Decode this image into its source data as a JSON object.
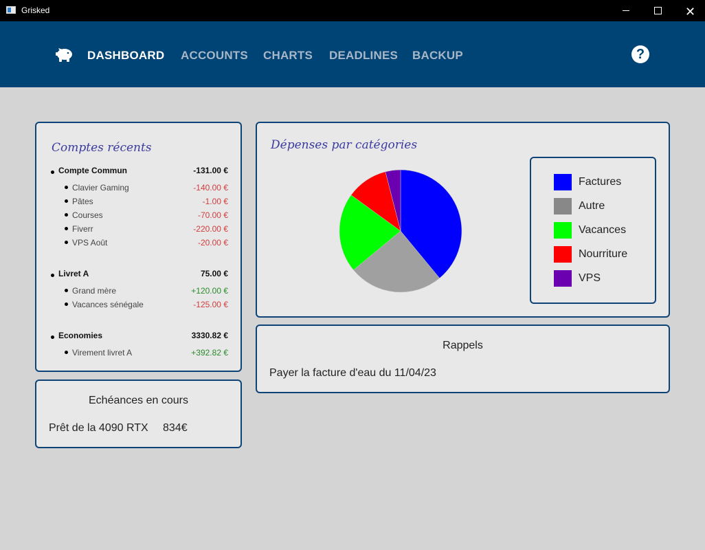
{
  "window": {
    "title": "Grisked"
  },
  "nav": {
    "items": [
      "DASHBOARD",
      "ACCOUNTS",
      "CHARTS",
      "DEADLINES",
      "BACKUP"
    ],
    "active": "DASHBOARD",
    "help": "?"
  },
  "comptes": {
    "title": "Comptes récents",
    "accounts": [
      {
        "name": "Compte Commun",
        "amount": "-131.00 €",
        "items": [
          {
            "label": "Clavier Gaming",
            "amount": "-140.00 €"
          },
          {
            "label": "Pâtes",
            "amount": "-1.00 €"
          },
          {
            "label": "Courses",
            "amount": "-70.00 €"
          },
          {
            "label": "Fiverr",
            "amount": "-220.00 €"
          },
          {
            "label": "VPS Août",
            "amount": "-20.00 €"
          }
        ]
      },
      {
        "name": "Livret A",
        "amount": "75.00 €",
        "items": [
          {
            "label": "Grand mère",
            "amount": "+120.00 €"
          },
          {
            "label": "Vacances sénégale",
            "amount": "-125.00 €"
          }
        ]
      },
      {
        "name": "Economies",
        "amount": "3330.82 €",
        "items": [
          {
            "label": "Virement livret A",
            "amount": "+392.82 €"
          }
        ]
      }
    ]
  },
  "echeances": {
    "title": "Echéances en cours",
    "item_label": "Prêt de la 4090 RTX",
    "item_amount": "834€"
  },
  "depenses": {
    "title": "Dépenses par catégories"
  },
  "rappels": {
    "title": "Rappels",
    "item": "Payer la facture d'eau du 11/04/23"
  },
  "chart_data": {
    "type": "pie",
    "title": "Dépenses par catégories",
    "categories": [
      "Factures",
      "Autre",
      "Vacances",
      "Nourriture",
      "VPS"
    ],
    "values": [
      39,
      25,
      21,
      11,
      4
    ],
    "colors": [
      "#0000ff",
      "#a0a0a0",
      "#00ff00",
      "#ff0000",
      "#6a00b0"
    ],
    "legend_colors": [
      "#0000ff",
      "#888888",
      "#00ff00",
      "#ff0000",
      "#6a00b0"
    ],
    "legend": "right"
  }
}
